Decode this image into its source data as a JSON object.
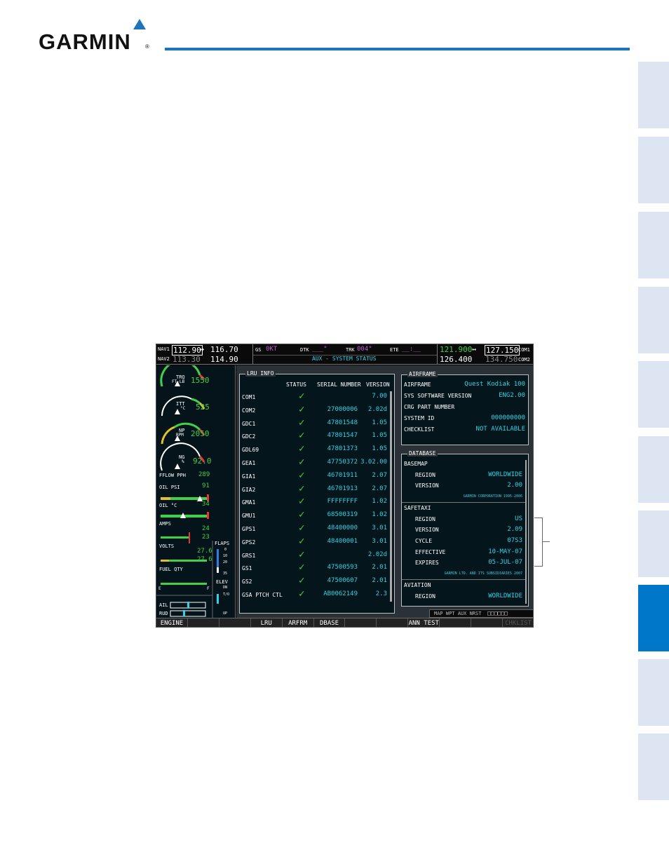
{
  "header": {
    "brand": "GARMIN",
    "reg_mark": "®"
  },
  "top_bar": {
    "nav1_label": "NAV1",
    "nav1_active": "112.90",
    "nav1_standby": "116.70",
    "nav2_label": "NAV2",
    "nav2_active": "113.30",
    "nav2_standby": "114.90",
    "swap_glyph": "↔",
    "gs_label": "GS",
    "gs_value": "0KT",
    "dtk_label": "DTK",
    "dtk_value": "___°",
    "trk_label": "TRK",
    "trk_value": "004°",
    "ete_label": "ETE",
    "ete_value": "__:__",
    "page_title": "AUX - SYSTEM STATUS",
    "com1_active": "121.900",
    "com1_standby": "127.150",
    "com1_label": "COM1",
    "com2_active": "126.400",
    "com2_standby": "134.750",
    "com2_label": "COM2"
  },
  "eis": {
    "trq_label": "TRQ",
    "trq_unit": "FT-LB",
    "trq_value": "1550",
    "itt_label": "ITT",
    "itt_unit": "°C",
    "itt_value": "525",
    "np_label": "NP",
    "np_unit": "RPM",
    "np_value": "2050",
    "ng_label": "NG",
    "ng_unit": "%",
    "ng_value": "92.0",
    "fflow_label": "FFLOW PPH",
    "fflow_value": "289",
    "oil_psi_label": "OIL PSI",
    "oil_psi_value": "91",
    "oil_c_label": "OIL °C",
    "oil_c_value": "34",
    "amps_label": "AMPS",
    "amps_value1": "24",
    "amps_value2": "23",
    "volts_label": "VOLTS",
    "volts_value1": "27.6",
    "volts_value2": "27.6",
    "fuel_label": "FUEL QTY",
    "fuel_e": "E",
    "fuel_f": "F",
    "flaps_label": "FLAPS",
    "flaps_0": "0",
    "flaps_10": "10",
    "flaps_20": "20",
    "flaps_35": "35",
    "elev_label": "ELEV",
    "elev_dn": "DN",
    "elev_to": "T/O",
    "elev_up": "UP",
    "ail_label": "AIL",
    "rud_label": "RUD"
  },
  "lru": {
    "title": "LRU INFO",
    "columns": [
      "STATUS",
      "SERIAL NUMBER",
      "VERSION"
    ],
    "rows": [
      {
        "name": "COM1",
        "serial": "",
        "version": "7.00"
      },
      {
        "name": "COM2",
        "serial": "27000006",
        "version": "2.02d"
      },
      {
        "name": "GDC1",
        "serial": "47801548",
        "version": "1.05"
      },
      {
        "name": "GDC2",
        "serial": "47801547",
        "version": "1.05"
      },
      {
        "name": "GDL69",
        "serial": "47801373",
        "version": "1.05"
      },
      {
        "name": "GEA1",
        "serial": "47750372",
        "version": "3.02.00"
      },
      {
        "name": "GIA1",
        "serial": "46701911",
        "version": "2.07"
      },
      {
        "name": "GIA2",
        "serial": "46701913",
        "version": "2.07"
      },
      {
        "name": "GMA1",
        "serial": "FFFFFFFF",
        "version": "1.02"
      },
      {
        "name": "GMU1",
        "serial": "68500319",
        "version": "1.02"
      },
      {
        "name": "GPS1",
        "serial": "48400000",
        "version": "3.01"
      },
      {
        "name": "GPS2",
        "serial": "48400001",
        "version": "3.01"
      },
      {
        "name": "GRS1",
        "serial": "",
        "version": "2.02d"
      },
      {
        "name": "GS1",
        "serial": "47500593",
        "version": "2.01"
      },
      {
        "name": "GS2",
        "serial": "47500607",
        "version": "2.01"
      },
      {
        "name": "GSA PTCH CTL",
        "serial": "AB0062149",
        "version": "2.3"
      }
    ],
    "check_glyph": "✓"
  },
  "airframe": {
    "title": "AIRFRAME",
    "airframe_label": "AIRFRAME",
    "airframe_value": "Quest Kodiak 100",
    "sys_sw_label": "SYS SOFTWARE VERSION",
    "sys_sw_value": "ENG2.00",
    "crg_label": "CRG PART NUMBER",
    "system_id_label": "SYSTEM ID",
    "system_id_value": "000000000",
    "checklist_label": "CHECKLIST",
    "checklist_value": "NOT AVAILABLE"
  },
  "database": {
    "title": "DATABASE",
    "basemap_label": "BASEMAP",
    "bm_region_label": "REGION",
    "bm_region_value": "WORLDWIDE",
    "bm_version_label": "VERSION",
    "bm_version_value": "2.00",
    "bm_copyright": "GARMIN CORPORATION 1995-2006",
    "safetaxi_label": "SAFETAXI",
    "st_region_label": "REGION",
    "st_region_value": "US",
    "st_version_label": "VERSION",
    "st_version_value": "2.09",
    "st_cycle_label": "CYCLE",
    "st_cycle_value": "07S3",
    "st_effective_label": "EFFECTIVE",
    "st_effective_value": "10-MAY-07",
    "st_expires_label": "EXPIRES",
    "st_expires_value": "05-JUL-07",
    "st_copyright": "GARMIN LTD. AND ITS SUBSIDIARIES 2007",
    "aviation_label": "AVIATION",
    "av_region_label": "REGION",
    "av_region_value": "WORLDWIDE"
  },
  "page_group": {
    "text": "MAP WPT AUX NRST",
    "boxes": "□□□□□□"
  },
  "softkeys": [
    "ENGINE",
    "",
    "",
    "LRU",
    "ARFRM",
    "DBASE",
    "",
    "",
    "ANN TEST",
    "",
    "",
    "CHKLIST"
  ]
}
